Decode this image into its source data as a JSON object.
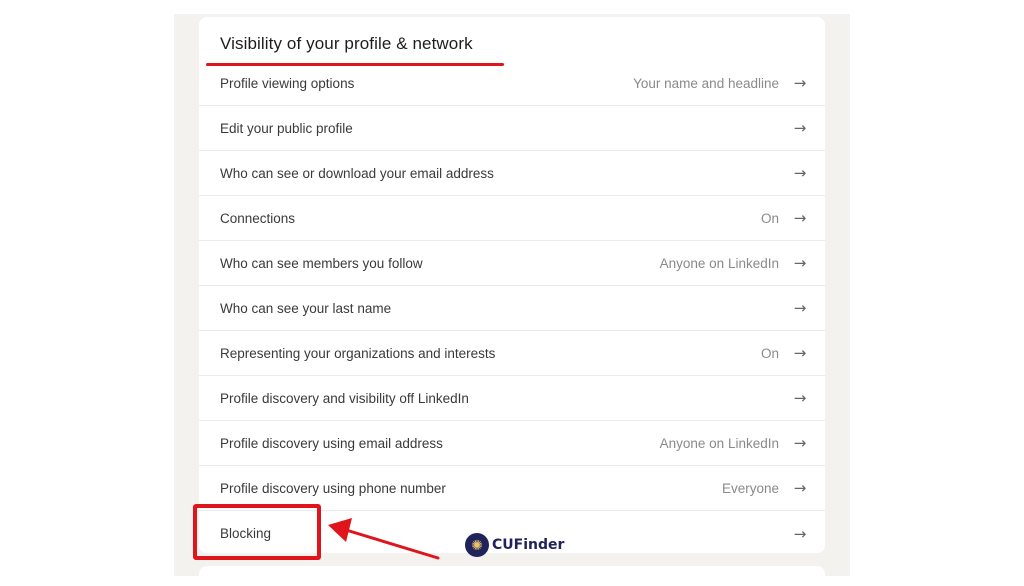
{
  "section": {
    "title": "Visibility of your profile & network",
    "rows": [
      {
        "label": "Profile viewing options",
        "value": "Your name and headline",
        "icon": "arrow-right-icon"
      },
      {
        "label": "Edit your public profile",
        "value": "",
        "icon": "arrow-right-icon"
      },
      {
        "label": "Who can see or download your email address",
        "value": "",
        "icon": "arrow-right-icon"
      },
      {
        "label": "Connections",
        "value": "On",
        "icon": "arrow-right-icon"
      },
      {
        "label": "Who can see members you follow",
        "value": "Anyone on LinkedIn",
        "icon": "arrow-right-icon"
      },
      {
        "label": "Who can see your last name",
        "value": "",
        "icon": "arrow-right-icon"
      },
      {
        "label": "Representing your organizations and interests",
        "value": "On",
        "icon": "arrow-right-icon"
      },
      {
        "label": "Profile discovery and visibility off LinkedIn",
        "value": "",
        "icon": "arrow-right-icon"
      },
      {
        "label": "Profile discovery using email address",
        "value": "Anyone on LinkedIn",
        "icon": "arrow-right-icon"
      },
      {
        "label": "Profile discovery using phone number",
        "value": "Everyone",
        "icon": "arrow-right-icon"
      },
      {
        "label": "Blocking",
        "value": "",
        "icon": "arrow-right-icon"
      }
    ]
  },
  "arrow_glyph": "→",
  "annotation": {
    "highlight_color": "#e0141b",
    "highlighted_row": "Blocking"
  },
  "watermark": {
    "text": "CUFinder",
    "icon": "starburst-icon",
    "glyph": "✺",
    "color": "#20235a"
  }
}
